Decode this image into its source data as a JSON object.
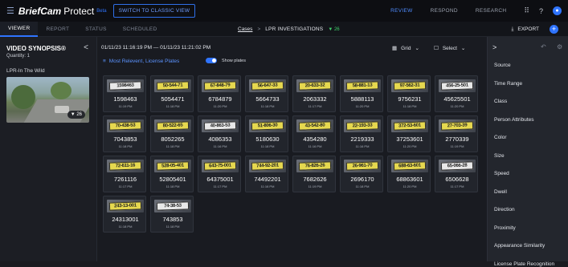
{
  "topbar": {
    "menu_icon": "hamburger-icon",
    "brand": "BriefCam",
    "product": "Protect",
    "product_sup": "Beta",
    "switch_label": "SWITCH TO CLASSIC VIEW",
    "nav": [
      "REVIEW",
      "RESPOND",
      "RESEARCH"
    ],
    "active_nav": "REVIEW",
    "accent_color": "#2f74ff"
  },
  "subbar": {
    "tabs": [
      "VIEWER",
      "REPORT",
      "STATUS",
      "SCHEDULED"
    ],
    "active_tab": "VIEWER",
    "breadcrumb_root": "Cases",
    "breadcrumb_sep": ">",
    "breadcrumb_current": "LPR INVESTIGATIONS",
    "filter_count": "▼ 26",
    "export_label": "EXPORT",
    "plus_label": "+"
  },
  "left": {
    "title": "VIDEO SYNOPSIS®",
    "quantity": "Quantity: 1",
    "camera": "LPR-In The Wild",
    "thumb_badge": "▼ 26",
    "collapse_glyph": "<"
  },
  "main": {
    "date_range": "01/11/23 11:16:19 PM — 01/11/23 11:21:02 PM",
    "sort_label": "Most Relevent, License Plates",
    "sort_icon": "sort-lines-icon",
    "show_plates_label": "Show plates",
    "grid_label": "Grid",
    "select_label": "Select"
  },
  "cards": [
    {
      "plate": "1598463",
      "number": "1598463",
      "time": "11:19 PM",
      "white": true
    },
    {
      "plate": "50-544-71",
      "number": "5054471",
      "time": "11:18 PM",
      "white": false
    },
    {
      "plate": "67-848-79",
      "number": "6784879",
      "time": "11:20 PM",
      "white": false
    },
    {
      "plate": "56-647-33",
      "number": "5664733",
      "time": "11:18 PM",
      "white": false
    },
    {
      "plate": "20-633-32",
      "number": "2063332",
      "time": "11:17 PM",
      "white": false
    },
    {
      "plate": "58-881-13",
      "number": "5888113",
      "time": "11:20 PM",
      "white": false
    },
    {
      "plate": "97-562-31",
      "number": "9756231",
      "time": "11:18 PM",
      "white": false
    },
    {
      "plate": "456-25-501",
      "number": "45625501",
      "time": "11:20 PM",
      "white": true
    },
    {
      "plate": "70-438-53",
      "number": "7043853",
      "time": "11:18 PM",
      "white": false
    },
    {
      "plate": "80-522-65",
      "number": "8052265",
      "time": "11:18 PM",
      "white": false
    },
    {
      "plate": "40-863-53",
      "number": "4086353",
      "time": "11:16 PM",
      "white": true
    },
    {
      "plate": "51-806-30",
      "number": "5180630",
      "time": "11:18 PM",
      "white": false
    },
    {
      "plate": "43-542-80",
      "number": "4354280",
      "time": "11:16 PM",
      "white": false
    },
    {
      "plate": "22-193-33",
      "number": "2219333",
      "time": "11:16 PM",
      "white": false
    },
    {
      "plate": "372-53-601",
      "number": "37253601",
      "time": "11:20 PM",
      "white": false
    },
    {
      "plate": "27-703-39",
      "number": "2770339",
      "time": "11:19 PM",
      "white": false
    },
    {
      "plate": "72-611-16",
      "number": "7261116",
      "time": "11:17 PM",
      "white": false
    },
    {
      "plate": "528-05-401",
      "number": "52805401",
      "time": "11:18 PM",
      "white": false
    },
    {
      "plate": "643-75-001",
      "number": "64375001",
      "time": "11:17 PM",
      "white": false
    },
    {
      "plate": "744-92-201",
      "number": "74492201",
      "time": "11:16 PM",
      "white": false
    },
    {
      "plate": "76-826-26",
      "number": "7682626",
      "time": "11:19 PM",
      "white": false
    },
    {
      "plate": "26-961-70",
      "number": "2696170",
      "time": "11:18 PM",
      "white": false
    },
    {
      "plate": "688-63-601",
      "number": "68863601",
      "time": "11:20 PM",
      "white": false
    },
    {
      "plate": "65-066-28",
      "number": "6506628",
      "time": "11:17 PM",
      "white": true
    },
    {
      "plate": "243-13-001",
      "number": "24313001",
      "time": "11:18 PM",
      "white": false
    },
    {
      "plate": "74-38-53",
      "number": "743853",
      "time": "11:18 PM",
      "white": true
    }
  ],
  "right": {
    "chevron": ">",
    "filters": [
      "Source",
      "Time Range",
      "Class",
      "Person Attributes",
      "Color",
      "Size",
      "Speed",
      "Dwell",
      "Direction",
      "Proximity",
      "Appearance Similarity",
      "License Plate Recognition"
    ]
  }
}
